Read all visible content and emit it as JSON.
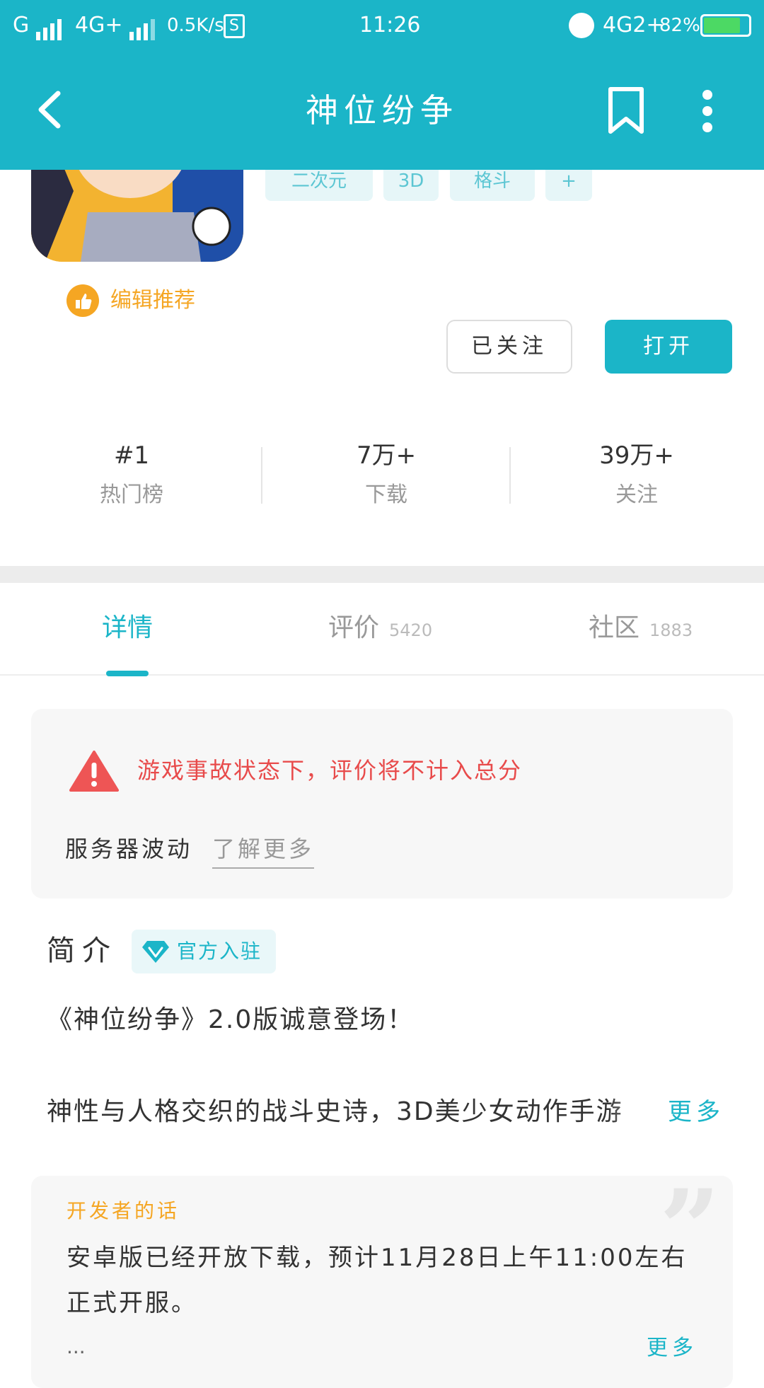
{
  "status_bar": {
    "carrier": "G",
    "network": "4G+",
    "speed": "0.5K/s",
    "time": "11:26",
    "network2": "4G2+",
    "battery": "82%",
    "battery_level": 0.82
  },
  "header": {
    "title": "神位纷争",
    "icons": [
      "back-icon",
      "bookmark-icon",
      "more-vertical-icon"
    ]
  },
  "app": {
    "tags": [
      "二次元",
      "3D",
      "格斗",
      "+"
    ],
    "editor_badge": "编辑推荐",
    "follow_label": "已关注",
    "open_label": "打开"
  },
  "stats": [
    {
      "value": "#1",
      "caption": "热门榜"
    },
    {
      "value": "7万+",
      "caption": "下载"
    },
    {
      "value": "39万+",
      "caption": "关注"
    }
  ],
  "tabs": [
    {
      "label": "详情",
      "count": ""
    },
    {
      "label": "评价",
      "count": "5420"
    },
    {
      "label": "社区",
      "count": "1883"
    }
  ],
  "notice": {
    "warning": "游戏事故状态下，评价将不计入总分",
    "status": "服务器波动",
    "link": "了解更多"
  },
  "intro": {
    "title": "简介",
    "badge": "官方入驻",
    "line1": "《神位纷争》2.0版诚意登场！",
    "line2": "神性与人格交织的战斗史诗，3D美少女动作手游",
    "more": "更多"
  },
  "developer": {
    "title": "开发者的话",
    "text": "安卓版已经开放下载，预计11月28日上午11:00左右正式开服。",
    "ellipsis": "...",
    "more": "更多"
  },
  "colors": {
    "accent": "#1bb5c8",
    "warning": "#e84b4b",
    "orange": "#f5a623"
  }
}
